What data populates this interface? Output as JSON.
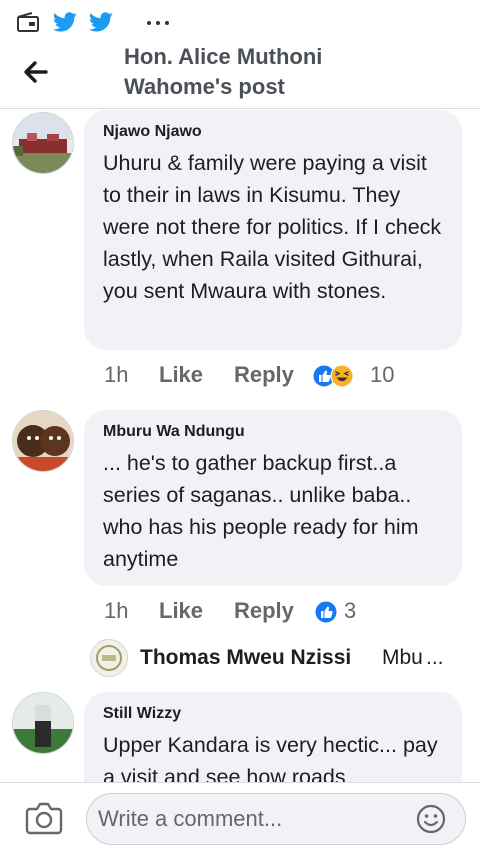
{
  "header": {
    "title": "Hon. Alice Muthoni Wahome's post"
  },
  "comments": [
    {
      "author": "Njawo Njawo",
      "text": "Uhuru & family were paying a visit to their in laws in Kisumu. They were not there for politics. If I check lastly, when Raila visited Githurai, you sent Mwaura with stones.",
      "time": "1h",
      "like_label": "Like",
      "reply_label": "Reply",
      "reactions": [
        "like",
        "haha"
      ],
      "reaction_count": "10"
    },
    {
      "author": "Mburu Wa Ndungu",
      "text": "... he's to gather backup first..a series of saganas.. unlike baba.. who has his people ready for him anytime",
      "time": "1h",
      "like_label": "Like",
      "reply_label": "Reply",
      "reactions": [
        "like"
      ],
      "reaction_count": "3"
    },
    {
      "author": "Still Wizzy",
      "text": "Upper Kandara is very hectic... pay a visit and see how roads"
    }
  ],
  "reply_preview": {
    "name": "Thomas Mweu Nzissi",
    "snippet": "Mbu",
    "more": "..."
  },
  "composer": {
    "placeholder": "Write a comment..."
  },
  "colors": {
    "brand_blue": "#1877f2",
    "bubble_bg": "#f0f2f5",
    "secondary_text": "#65676b"
  },
  "icons": [
    "wallet-icon",
    "twitter-icon",
    "twitter-icon",
    "more-icon",
    "back-arrow-icon",
    "like-reaction-icon",
    "haha-reaction-icon",
    "camera-icon",
    "emoji-icon"
  ]
}
